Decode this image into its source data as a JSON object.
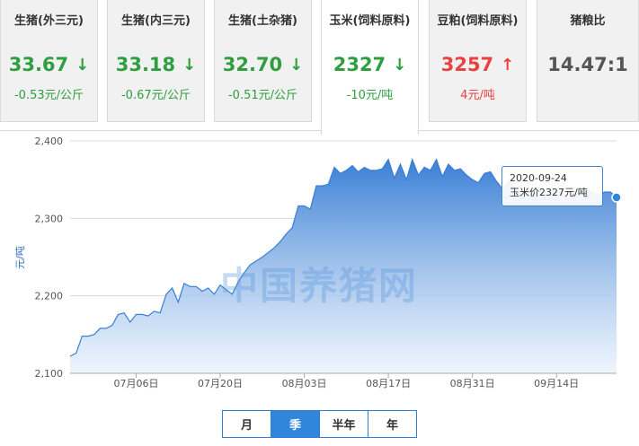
{
  "cards": [
    {
      "name": "生猪(外三元)",
      "price": "33.67",
      "direction": "down",
      "change": "-0.53元/公斤",
      "active": false
    },
    {
      "name": "生猪(内三元)",
      "price": "33.18",
      "direction": "down",
      "change": "-0.67元/公斤",
      "active": false
    },
    {
      "name": "生猪(土杂猪)",
      "price": "32.70",
      "direction": "down",
      "change": "-0.51元/公斤",
      "active": false
    },
    {
      "name": "玉米(饲料原料)",
      "price": "2327",
      "direction": "down",
      "change": "-10元/吨",
      "active": true
    },
    {
      "name": "豆粕(饲料原料)",
      "price": "3257",
      "direction": "up",
      "change": "4元/吨",
      "active": false
    },
    {
      "name": "猪粮比",
      "price": "14.47:1",
      "direction": "none",
      "change": "",
      "active": false
    }
  ],
  "colors": {
    "down": "#2e9e3e",
    "up": "#e8413f",
    "accent": "#2f86da",
    "area_top": "#3a7fd5",
    "area_bottom": "#e6f0fb"
  },
  "icons": {
    "down": "arrow-down-icon",
    "up": "arrow-up-icon"
  },
  "watermark": "中国养猪网",
  "tooltip": {
    "date": "2020-09-24",
    "text": "玉米价2327元/吨"
  },
  "periods": [
    {
      "label": "月",
      "active": false
    },
    {
      "label": "季",
      "active": true
    },
    {
      "label": "半年",
      "active": false
    },
    {
      "label": "年",
      "active": false
    }
  ],
  "chart_data": {
    "type": "area",
    "title": "",
    "xlabel": "",
    "ylabel": "元/吨",
    "ylim": [
      2100,
      2400
    ],
    "yticks": [
      "2,100",
      "2,200",
      "2,300",
      "2,400"
    ],
    "ytick_values": [
      2100,
      2200,
      2300,
      2400
    ],
    "xticks": [
      "07月06日",
      "07月20日",
      "08月03日",
      "08月17日",
      "08月31日",
      "09月14日"
    ],
    "xtick_dates": [
      "2020-07-06",
      "2020-07-20",
      "2020-08-03",
      "2020-08-17",
      "2020-08-31",
      "2020-09-14"
    ],
    "grid": true,
    "series": [
      {
        "name": "玉米价",
        "x": [
          "2020-06-25",
          "2020-06-26",
          "2020-06-27",
          "2020-06-28",
          "2020-06-29",
          "2020-06-30",
          "2020-07-01",
          "2020-07-02",
          "2020-07-03",
          "2020-07-04",
          "2020-07-05",
          "2020-07-06",
          "2020-07-07",
          "2020-07-08",
          "2020-07-09",
          "2020-07-10",
          "2020-07-11",
          "2020-07-12",
          "2020-07-13",
          "2020-07-14",
          "2020-07-15",
          "2020-07-16",
          "2020-07-17",
          "2020-07-18",
          "2020-07-19",
          "2020-07-20",
          "2020-07-21",
          "2020-07-22",
          "2020-07-23",
          "2020-07-24",
          "2020-07-25",
          "2020-07-26",
          "2020-07-27",
          "2020-07-28",
          "2020-07-29",
          "2020-07-30",
          "2020-07-31",
          "2020-08-01",
          "2020-08-02",
          "2020-08-03",
          "2020-08-04",
          "2020-08-05",
          "2020-08-06",
          "2020-08-07",
          "2020-08-08",
          "2020-08-09",
          "2020-08-10",
          "2020-08-11",
          "2020-08-12",
          "2020-08-13",
          "2020-08-14",
          "2020-08-15",
          "2020-08-16",
          "2020-08-17",
          "2020-08-18",
          "2020-08-19",
          "2020-08-20",
          "2020-08-21",
          "2020-08-22",
          "2020-08-23",
          "2020-08-24",
          "2020-08-25",
          "2020-08-26",
          "2020-08-27",
          "2020-08-28",
          "2020-08-29",
          "2020-08-30",
          "2020-08-31",
          "2020-09-01",
          "2020-09-02",
          "2020-09-03",
          "2020-09-04",
          "2020-09-05",
          "2020-09-06",
          "2020-09-07",
          "2020-09-08",
          "2020-09-09",
          "2020-09-10",
          "2020-09-11",
          "2020-09-12",
          "2020-09-13",
          "2020-09-14",
          "2020-09-15",
          "2020-09-16",
          "2020-09-17",
          "2020-09-18",
          "2020-09-19",
          "2020-09-20",
          "2020-09-21",
          "2020-09-22",
          "2020-09-23",
          "2020-09-24"
        ],
        "values": [
          2122,
          2126,
          2148,
          2148,
          2150,
          2158,
          2158,
          2162,
          2176,
          2178,
          2166,
          2176,
          2176,
          2174,
          2180,
          2178,
          2202,
          2210,
          2192,
          2216,
          2212,
          2212,
          2206,
          2210,
          2202,
          2214,
          2208,
          2202,
          2218,
          2230,
          2240,
          2245,
          2250,
          2256,
          2262,
          2270,
          2280,
          2288,
          2316,
          2316,
          2312,
          2342,
          2342,
          2344,
          2366,
          2358,
          2362,
          2368,
          2360,
          2366,
          2362,
          2362,
          2364,
          2376,
          2352,
          2370,
          2350,
          2376,
          2356,
          2366,
          2362,
          2376,
          2354,
          2370,
          2362,
          2364,
          2356,
          2350,
          2346,
          2358,
          2360,
          2348,
          2338,
          2348,
          2340,
          2330,
          2334,
          2334,
          2340,
          2330,
          2334,
          2336,
          2330,
          2326,
          2334,
          2330,
          2336,
          2334,
          2330,
          2334,
          2334,
          2327
        ]
      }
    ]
  }
}
